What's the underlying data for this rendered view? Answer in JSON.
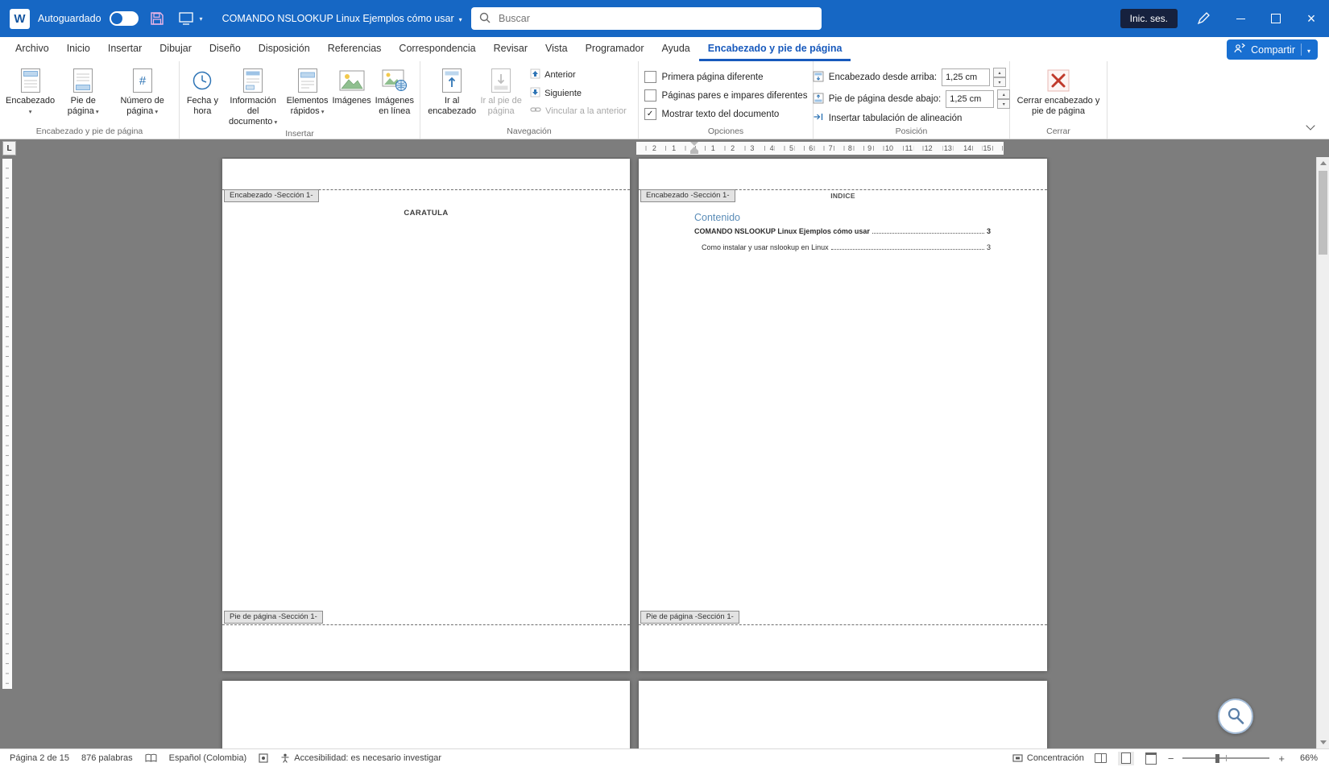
{
  "titlebar": {
    "autosave_label": "Autoguardado",
    "doc_title": "COMANDO NSLOOKUP Linux  Ejemplos cómo usar",
    "search_placeholder": "Buscar",
    "signin_label": "Inic. ses."
  },
  "tabs": {
    "archivo": "Archivo",
    "inicio": "Inicio",
    "insertar": "Insertar",
    "dibujar": "Dibujar",
    "diseno": "Diseño",
    "disposicion": "Disposición",
    "referencias": "Referencias",
    "correspondencia": "Correspondencia",
    "revisar": "Revisar",
    "vista": "Vista",
    "programador": "Programador",
    "ayuda": "Ayuda",
    "contextual": "Encabezado y pie de página"
  },
  "share_label": "Compartir",
  "ribbon": {
    "group1": {
      "label": "Encabezado y pie de página",
      "b_header": "Encabezado",
      "b_footer": "Pie de página",
      "b_pagenum": "Número de página"
    },
    "group2": {
      "label": "Insertar",
      "b_datetime": "Fecha y hora",
      "b_docinfo": "Información del documento",
      "b_quickparts": "Elementos rápidos",
      "b_pictures": "Imágenes",
      "b_online": "Imágenes en línea"
    },
    "group3": {
      "label": "Navegación",
      "b_goheader": "Ir al encabezado",
      "b_gofooter": "Ir al pie de página",
      "b_prev": "Anterior",
      "b_next": "Siguiente",
      "b_link": "Vincular a la anterior"
    },
    "group4": {
      "label": "Opciones",
      "c_firstpage": "Primera página diferente",
      "c_oddeven": "Páginas pares e impares diferentes",
      "c_showtext": "Mostrar texto del documento"
    },
    "group5": {
      "label": "Posición",
      "f_headertop": "Encabezado desde arriba:",
      "v_headertop": "1,25 cm",
      "f_footerbottom": "Pie de página desde abajo:",
      "v_footerbottom": "1,25 cm",
      "b_tab": "Insertar tabulación de alineación"
    },
    "group6": {
      "label": "Cerrar",
      "b_close": "Cerrar encabezado y pie de página"
    }
  },
  "ruler": {
    "numbers": [
      "1",
      "2",
      "3",
      "4",
      "5",
      "6",
      "7",
      "8",
      "9",
      "10",
      "11",
      "12",
      "13",
      "14",
      "15"
    ],
    "left_numbers": [
      "1",
      "2"
    ]
  },
  "doc": {
    "header_tag": "Encabezado -Sección 1-",
    "footer_tag": "Pie de página -Sección 1-",
    "page1_text": "CARATULA",
    "page2": {
      "header_text": "INDICE",
      "toc_heading": "Contenido",
      "toc": [
        {
          "text": "COMANDO NSLOOKUP Linux  Ejemplos cómo usar",
          "page": "3"
        },
        {
          "text": "Como instalar y usar nslookup en Linux",
          "page": "3"
        }
      ]
    }
  },
  "statusbar": {
    "page_info": "Página 2 de 15",
    "word_count": "876 palabras",
    "language": "Español (Colombia)",
    "accessibility": "Accesibilidad: es necesario investigar",
    "focus": "Concentración",
    "zoom": "66%"
  }
}
